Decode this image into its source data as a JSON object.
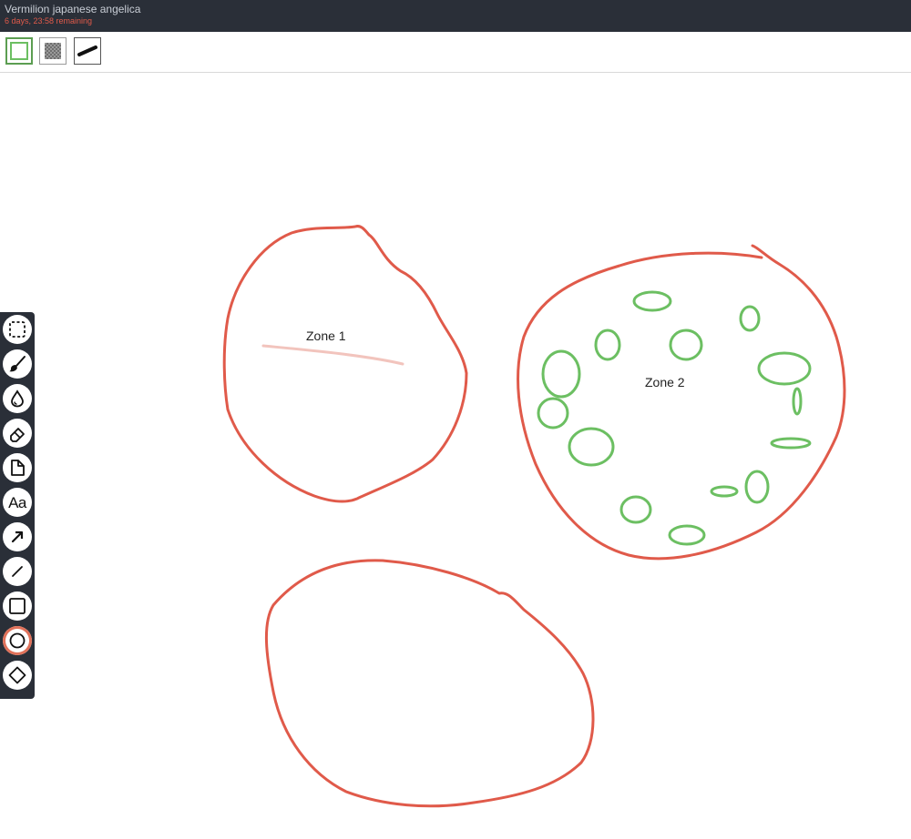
{
  "window": {
    "title": "Vermilion japanese angelica",
    "remaining": "6 days, 23:58 remaining"
  },
  "toolbar": {
    "items": [
      {
        "name": "fill-color",
        "icon": "fill-swatch-icon",
        "color": "#6cbf62"
      },
      {
        "name": "fill-pattern",
        "icon": "checker-pattern-icon"
      },
      {
        "name": "stroke-width",
        "icon": "stroke-line-icon"
      }
    ]
  },
  "canvas": {
    "zones": [
      {
        "label": "Zone 1"
      },
      {
        "label": "Zone 2"
      }
    ],
    "colors": {
      "zone_outline": "#e05a4a",
      "plants": "#6cbf62",
      "faint_line": "#f2c4bd"
    }
  },
  "tools": [
    {
      "name": "select-tool",
      "icon": "dashed-square-icon"
    },
    {
      "name": "brush-tool",
      "icon": "brush-icon"
    },
    {
      "name": "fill-tool",
      "icon": "droplet-icon"
    },
    {
      "name": "eraser-tool",
      "icon": "eraser-icon"
    },
    {
      "name": "note-tool",
      "icon": "page-icon"
    },
    {
      "name": "text-tool",
      "icon": "text-icon",
      "label": "Aa"
    },
    {
      "name": "arrow-tool",
      "icon": "arrow-icon"
    },
    {
      "name": "line-tool",
      "icon": "line-icon"
    },
    {
      "name": "rectangle-tool",
      "icon": "square-icon"
    },
    {
      "name": "ellipse-tool",
      "icon": "circle-icon",
      "active": true
    },
    {
      "name": "diamond-tool",
      "icon": "diamond-icon"
    }
  ]
}
